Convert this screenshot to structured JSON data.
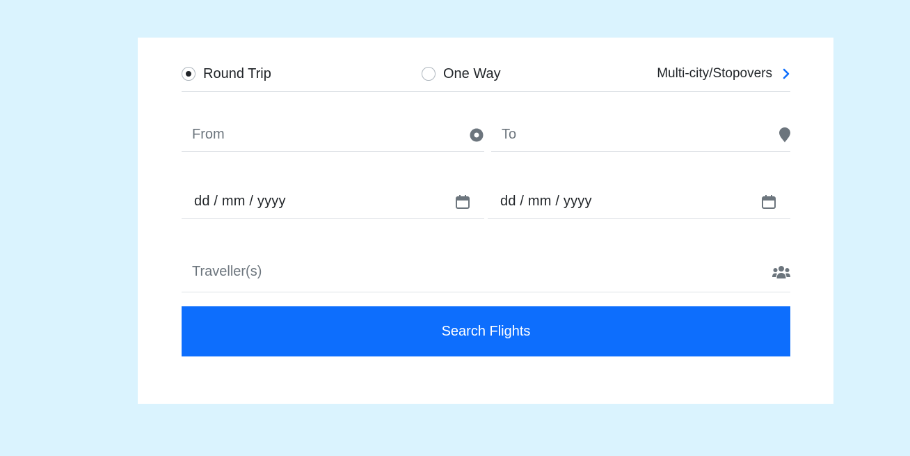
{
  "trip_type": {
    "options": [
      {
        "label": "Round Trip",
        "selected": true
      },
      {
        "label": "One Way",
        "selected": false
      }
    ],
    "multicity_label": "Multi-city/Stopovers"
  },
  "from": {
    "placeholder": "From",
    "icon": "map-marker-dot-icon"
  },
  "to": {
    "placeholder": "To",
    "icon": "map-pin-icon"
  },
  "depart_date": {
    "value": "dd / mm / yyyy",
    "icon": "calendar-icon"
  },
  "return_date": {
    "value": "dd / mm / yyyy",
    "icon": "calendar-icon"
  },
  "travellers": {
    "placeholder": "Traveller(s)",
    "icon": "users-icon"
  },
  "search_button": {
    "label": "Search Flights"
  },
  "colors": {
    "page_background": "#daf3fe",
    "card_background": "#ffffff",
    "primary": "#0d6efd",
    "icon_gray": "#6c757d",
    "divider": "#dee2e6"
  }
}
